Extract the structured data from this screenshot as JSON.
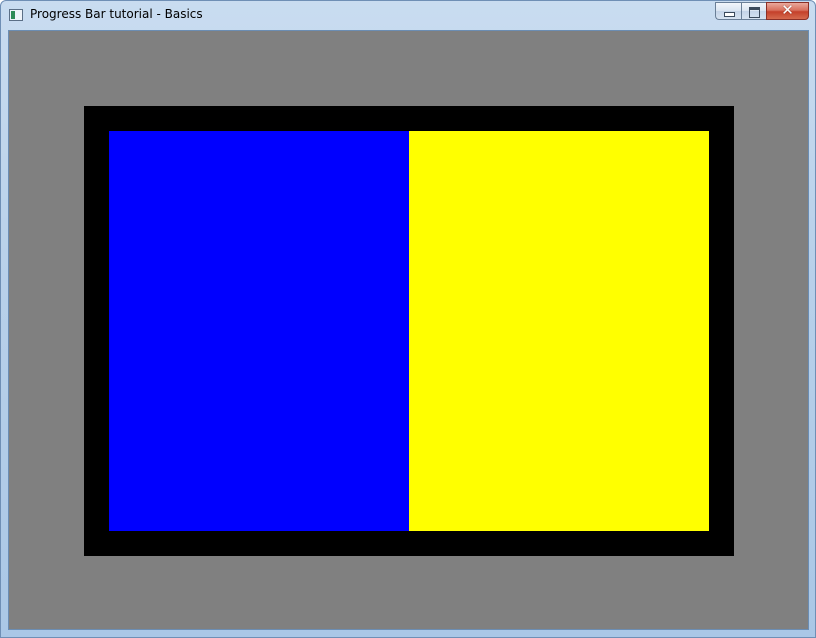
{
  "window": {
    "title": "Progress Bar tutorial - Basics",
    "icon": "app-window-icon",
    "caption_buttons": {
      "minimize_icon": "minimize-icon",
      "maximize_icon": "maximize-icon",
      "close_icon": "close-icon",
      "close_glyph": "✕"
    }
  },
  "client": {
    "background_color": "#808080"
  },
  "progress_bar": {
    "progress": 0.5,
    "border_color": "#000000",
    "fill_color": "#0000ff",
    "track_color": "#ffff00"
  }
}
